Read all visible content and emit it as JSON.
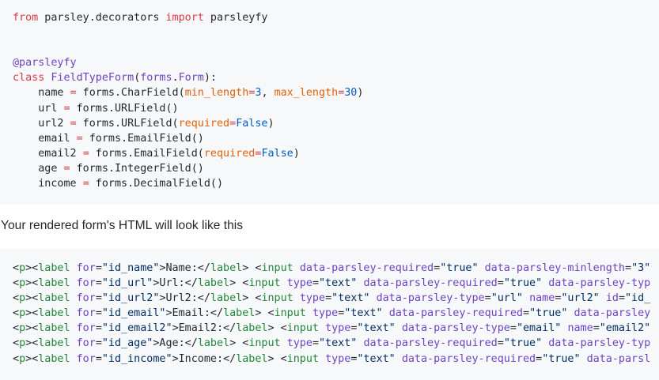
{
  "python_block": {
    "lines": [
      [
        {
          "t": "from",
          "c": "kw"
        },
        {
          "t": " parsley.decorators "
        },
        {
          "t": "import",
          "c": "kw"
        },
        {
          "t": " parsleyfy"
        }
      ],
      [],
      [],
      [
        {
          "t": "@parsleyfy",
          "c": "dec"
        }
      ],
      [
        {
          "t": "class",
          "c": "kw"
        },
        {
          "t": " "
        },
        {
          "t": "FieldTypeForm",
          "c": "ent"
        },
        {
          "t": "("
        },
        {
          "t": "forms",
          "c": "ent"
        },
        {
          "t": "."
        },
        {
          "t": "Form",
          "c": "ent"
        },
        {
          "t": "):"
        }
      ],
      [
        {
          "t": "    name "
        },
        {
          "t": "=",
          "c": "kw"
        },
        {
          "t": " forms.CharField("
        },
        {
          "t": "min_length",
          "c": "param"
        },
        {
          "t": "=",
          "c": "kw"
        },
        {
          "t": "3",
          "c": "num"
        },
        {
          "t": ", "
        },
        {
          "t": "max_length",
          "c": "param"
        },
        {
          "t": "=",
          "c": "kw"
        },
        {
          "t": "30",
          "c": "num"
        },
        {
          "t": ")"
        }
      ],
      [
        {
          "t": "    url "
        },
        {
          "t": "=",
          "c": "kw"
        },
        {
          "t": " forms.URLField()"
        }
      ],
      [
        {
          "t": "    url2 "
        },
        {
          "t": "=",
          "c": "kw"
        },
        {
          "t": " forms.URLField("
        },
        {
          "t": "required",
          "c": "param"
        },
        {
          "t": "=",
          "c": "kw"
        },
        {
          "t": "False",
          "c": "const"
        },
        {
          "t": ")"
        }
      ],
      [
        {
          "t": "    email "
        },
        {
          "t": "=",
          "c": "kw"
        },
        {
          "t": " forms.EmailField()"
        }
      ],
      [
        {
          "t": "    email2 "
        },
        {
          "t": "=",
          "c": "kw"
        },
        {
          "t": " forms.EmailField("
        },
        {
          "t": "required",
          "c": "param"
        },
        {
          "t": "=",
          "c": "kw"
        },
        {
          "t": "False",
          "c": "const"
        },
        {
          "t": ")"
        }
      ],
      [
        {
          "t": "    age "
        },
        {
          "t": "=",
          "c": "kw"
        },
        {
          "t": " forms.IntegerField()"
        }
      ],
      [
        {
          "t": "    income "
        },
        {
          "t": "=",
          "c": "kw"
        },
        {
          "t": " forms.DecimalField()"
        }
      ]
    ]
  },
  "prose": "Your rendered form's HTML will look like this",
  "html_block": {
    "lines": [
      [
        {
          "t": "<"
        },
        {
          "t": "p",
          "c": "tag"
        },
        {
          "t": "><"
        },
        {
          "t": "label",
          "c": "tag"
        },
        {
          "t": " "
        },
        {
          "t": "for",
          "c": "attr"
        },
        {
          "t": "="
        },
        {
          "t": "\"id_name\"",
          "c": "str"
        },
        {
          "t": ">Name:</"
        },
        {
          "t": "label",
          "c": "tag"
        },
        {
          "t": "> <"
        },
        {
          "t": "input",
          "c": "tag"
        },
        {
          "t": " "
        },
        {
          "t": "data-parsley-required",
          "c": "attr"
        },
        {
          "t": "="
        },
        {
          "t": "\"true\"",
          "c": "str"
        },
        {
          "t": " "
        },
        {
          "t": "data-parsley-minlength",
          "c": "attr"
        },
        {
          "t": "="
        },
        {
          "t": "\"3\"",
          "c": "str"
        }
      ],
      [
        {
          "t": "<"
        },
        {
          "t": "p",
          "c": "tag"
        },
        {
          "t": "><"
        },
        {
          "t": "label",
          "c": "tag"
        },
        {
          "t": " "
        },
        {
          "t": "for",
          "c": "attr"
        },
        {
          "t": "="
        },
        {
          "t": "\"id_url\"",
          "c": "str"
        },
        {
          "t": ">Url:</"
        },
        {
          "t": "label",
          "c": "tag"
        },
        {
          "t": "> <"
        },
        {
          "t": "input",
          "c": "tag"
        },
        {
          "t": " "
        },
        {
          "t": "type",
          "c": "attr"
        },
        {
          "t": "="
        },
        {
          "t": "\"text\"",
          "c": "str"
        },
        {
          "t": " "
        },
        {
          "t": "data-parsley-required",
          "c": "attr"
        },
        {
          "t": "="
        },
        {
          "t": "\"true\"",
          "c": "str"
        },
        {
          "t": " "
        },
        {
          "t": "data-parsley-typ",
          "c": "attr"
        }
      ],
      [
        {
          "t": "<"
        },
        {
          "t": "p",
          "c": "tag"
        },
        {
          "t": "><"
        },
        {
          "t": "label",
          "c": "tag"
        },
        {
          "t": " "
        },
        {
          "t": "for",
          "c": "attr"
        },
        {
          "t": "="
        },
        {
          "t": "\"id_url2\"",
          "c": "str"
        },
        {
          "t": ">Url2:</"
        },
        {
          "t": "label",
          "c": "tag"
        },
        {
          "t": "> <"
        },
        {
          "t": "input",
          "c": "tag"
        },
        {
          "t": " "
        },
        {
          "t": "type",
          "c": "attr"
        },
        {
          "t": "="
        },
        {
          "t": "\"text\"",
          "c": "str"
        },
        {
          "t": " "
        },
        {
          "t": "data-parsley-type",
          "c": "attr"
        },
        {
          "t": "="
        },
        {
          "t": "\"url\"",
          "c": "str"
        },
        {
          "t": " "
        },
        {
          "t": "name",
          "c": "attr"
        },
        {
          "t": "="
        },
        {
          "t": "\"url2\"",
          "c": "str"
        },
        {
          "t": " "
        },
        {
          "t": "id",
          "c": "attr"
        },
        {
          "t": "="
        },
        {
          "t": "\"id_",
          "c": "str"
        }
      ],
      [
        {
          "t": "<"
        },
        {
          "t": "p",
          "c": "tag"
        },
        {
          "t": "><"
        },
        {
          "t": "label",
          "c": "tag"
        },
        {
          "t": " "
        },
        {
          "t": "for",
          "c": "attr"
        },
        {
          "t": "="
        },
        {
          "t": "\"id_email\"",
          "c": "str"
        },
        {
          "t": ">Email:</"
        },
        {
          "t": "label",
          "c": "tag"
        },
        {
          "t": "> <"
        },
        {
          "t": "input",
          "c": "tag"
        },
        {
          "t": " "
        },
        {
          "t": "type",
          "c": "attr"
        },
        {
          "t": "="
        },
        {
          "t": "\"text\"",
          "c": "str"
        },
        {
          "t": " "
        },
        {
          "t": "data-parsley-required",
          "c": "attr"
        },
        {
          "t": "="
        },
        {
          "t": "\"true\"",
          "c": "str"
        },
        {
          "t": " "
        },
        {
          "t": "data-parsley",
          "c": "attr"
        }
      ],
      [
        {
          "t": "<"
        },
        {
          "t": "p",
          "c": "tag"
        },
        {
          "t": "><"
        },
        {
          "t": "label",
          "c": "tag"
        },
        {
          "t": " "
        },
        {
          "t": "for",
          "c": "attr"
        },
        {
          "t": "="
        },
        {
          "t": "\"id_email2\"",
          "c": "str"
        },
        {
          "t": ">Email2:</"
        },
        {
          "t": "label",
          "c": "tag"
        },
        {
          "t": "> <"
        },
        {
          "t": "input",
          "c": "tag"
        },
        {
          "t": " "
        },
        {
          "t": "type",
          "c": "attr"
        },
        {
          "t": "="
        },
        {
          "t": "\"text\"",
          "c": "str"
        },
        {
          "t": " "
        },
        {
          "t": "data-parsley-type",
          "c": "attr"
        },
        {
          "t": "="
        },
        {
          "t": "\"email\"",
          "c": "str"
        },
        {
          "t": " "
        },
        {
          "t": "name",
          "c": "attr"
        },
        {
          "t": "="
        },
        {
          "t": "\"email2\"",
          "c": "str"
        }
      ],
      [
        {
          "t": "<"
        },
        {
          "t": "p",
          "c": "tag"
        },
        {
          "t": "><"
        },
        {
          "t": "label",
          "c": "tag"
        },
        {
          "t": " "
        },
        {
          "t": "for",
          "c": "attr"
        },
        {
          "t": "="
        },
        {
          "t": "\"id_age\"",
          "c": "str"
        },
        {
          "t": ">Age:</"
        },
        {
          "t": "label",
          "c": "tag"
        },
        {
          "t": "> <"
        },
        {
          "t": "input",
          "c": "tag"
        },
        {
          "t": " "
        },
        {
          "t": "type",
          "c": "attr"
        },
        {
          "t": "="
        },
        {
          "t": "\"text\"",
          "c": "str"
        },
        {
          "t": " "
        },
        {
          "t": "data-parsley-required",
          "c": "attr"
        },
        {
          "t": "="
        },
        {
          "t": "\"true\"",
          "c": "str"
        },
        {
          "t": " "
        },
        {
          "t": "data-parsley-typ",
          "c": "attr"
        }
      ],
      [
        {
          "t": "<"
        },
        {
          "t": "p",
          "c": "tag"
        },
        {
          "t": "><"
        },
        {
          "t": "label",
          "c": "tag"
        },
        {
          "t": " "
        },
        {
          "t": "for",
          "c": "attr"
        },
        {
          "t": "="
        },
        {
          "t": "\"id_income\"",
          "c": "str"
        },
        {
          "t": ">Income:</"
        },
        {
          "t": "label",
          "c": "tag"
        },
        {
          "t": "> <"
        },
        {
          "t": "input",
          "c": "tag"
        },
        {
          "t": " "
        },
        {
          "t": "type",
          "c": "attr"
        },
        {
          "t": "="
        },
        {
          "t": "\"text\"",
          "c": "str"
        },
        {
          "t": " "
        },
        {
          "t": "data-parsley-required",
          "c": "attr"
        },
        {
          "t": "="
        },
        {
          "t": "\"true\"",
          "c": "str"
        },
        {
          "t": " "
        },
        {
          "t": "data-parsl",
          "c": "attr"
        }
      ]
    ]
  },
  "colors": {
    "code_background": "#f6f8fa",
    "text": "#24292e",
    "keyword": "#d73a49",
    "decorator": "#6f42c1",
    "number": "#005cc5",
    "parameter": "#e36209",
    "tag": "#22863a",
    "attribute": "#6f42c1",
    "string": "#032f62"
  }
}
